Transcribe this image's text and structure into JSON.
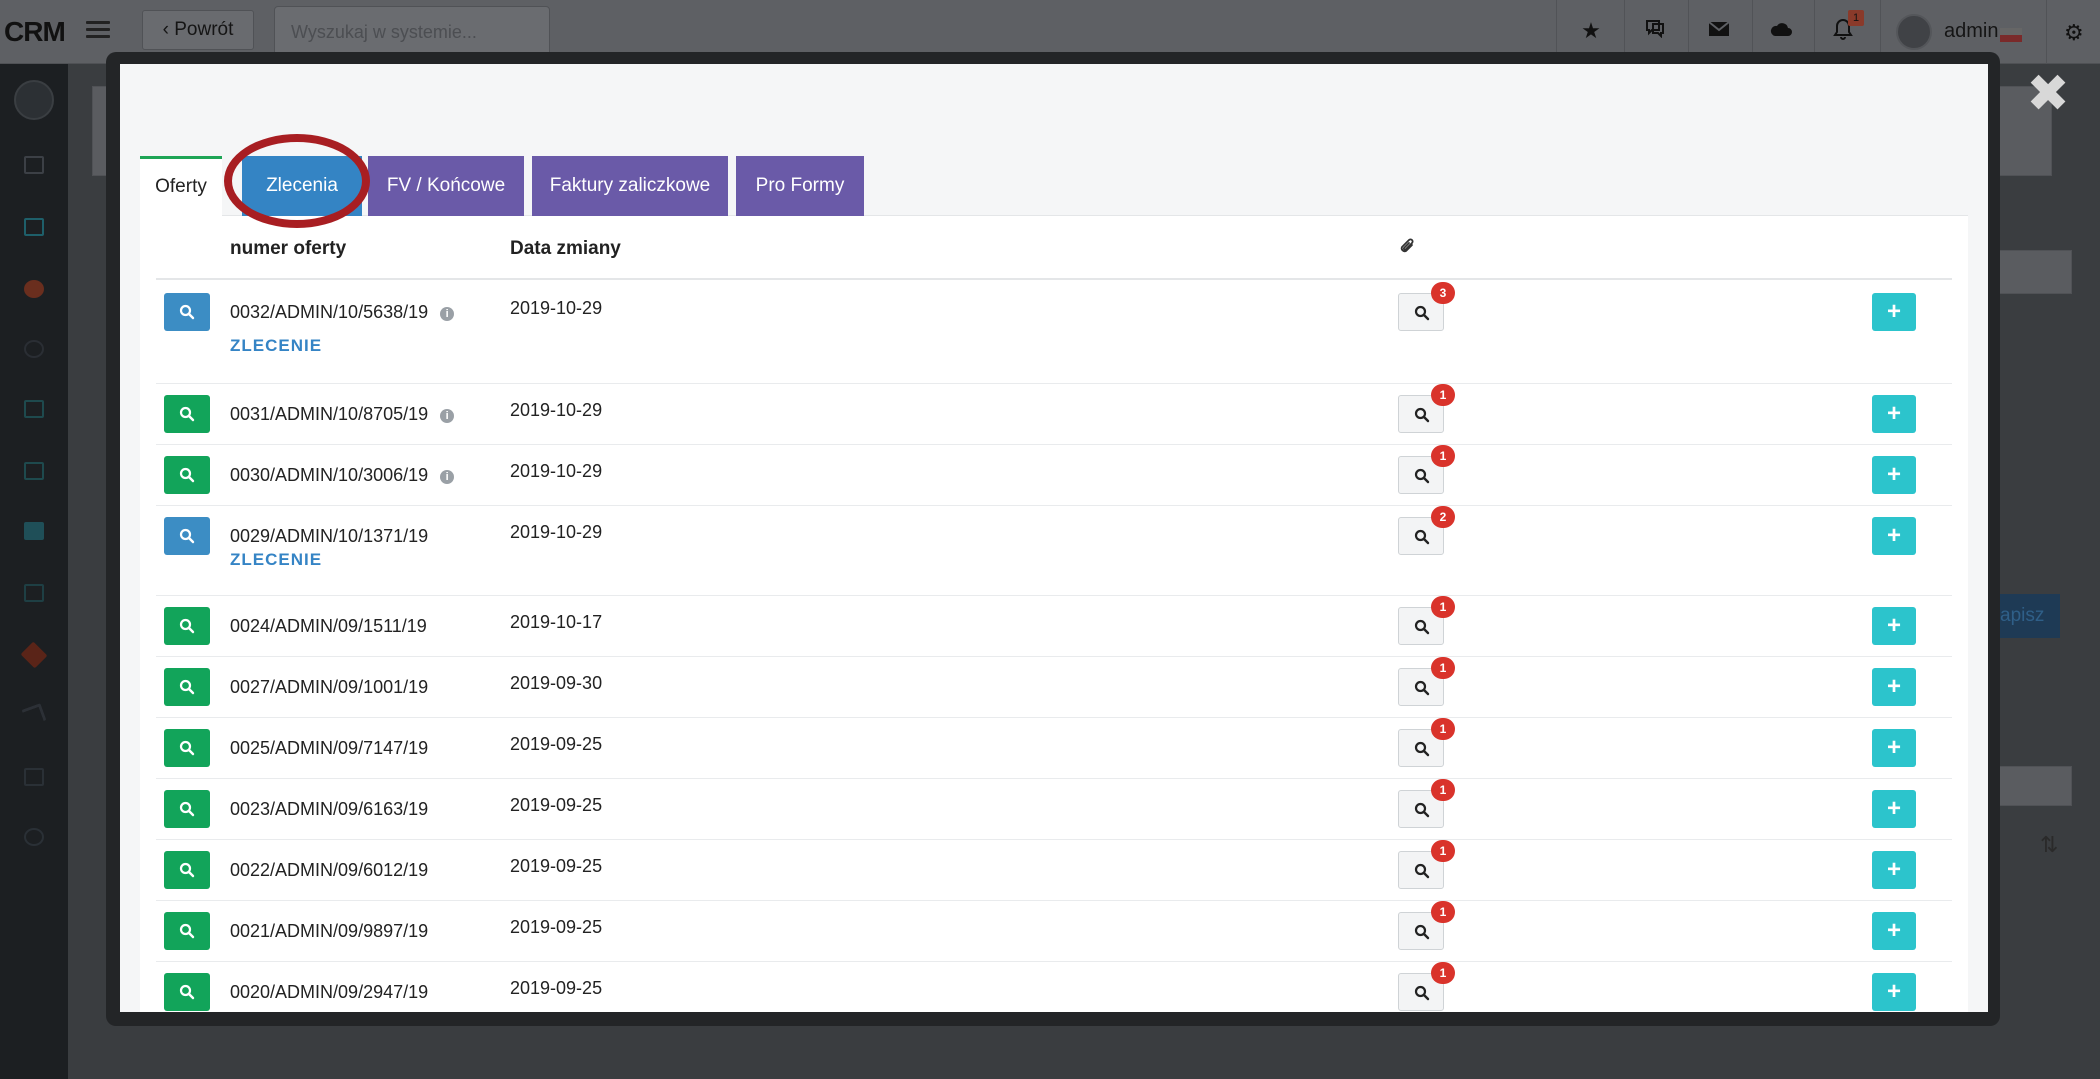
{
  "app": {
    "brand": "CRM",
    "back_label": "Powrót",
    "search_placeholder": "Wyszukaj w systemie...",
    "notification_count": "1",
    "user_name": "admin",
    "save_fragment": "apisz"
  },
  "modal": {
    "close_label": "✖",
    "tabs": [
      {
        "label": "Oferty",
        "state": "active"
      },
      {
        "label": "Zlecenia",
        "state": "highlighted"
      },
      {
        "label": "FV / Końcowe",
        "state": "normal"
      },
      {
        "label": "Faktury zaliczkowe",
        "state": "normal"
      },
      {
        "label": "Pro Formy",
        "state": "normal"
      }
    ],
    "columns": {
      "number": "numer oferty",
      "date": "Data zmiany",
      "attachments_icon": "paperclip-icon"
    },
    "rows": [
      {
        "number": "0032/ADMIN/10/5638/19",
        "info": true,
        "tag": "ZLECENIE",
        "date": "2019-10-29",
        "attachments": "3",
        "button": "blue"
      },
      {
        "number": "0031/ADMIN/10/8705/19",
        "info": true,
        "tag": "",
        "date": "2019-10-29",
        "attachments": "1",
        "button": "green"
      },
      {
        "number": "0030/ADMIN/10/3006/19",
        "info": true,
        "tag": "",
        "date": "2019-10-29",
        "attachments": "1",
        "button": "green"
      },
      {
        "number": "0029/ADMIN/10/1371/19",
        "info": false,
        "tag": "ZLECENIE",
        "date": "2019-10-29",
        "attachments": "2",
        "button": "blue"
      },
      {
        "number": "0024/ADMIN/09/1511/19",
        "info": false,
        "tag": "",
        "date": "2019-10-17",
        "attachments": "1",
        "button": "green"
      },
      {
        "number": "0027/ADMIN/09/1001/19",
        "info": false,
        "tag": "",
        "date": "2019-09-30",
        "attachments": "1",
        "button": "green"
      },
      {
        "number": "0025/ADMIN/09/7147/19",
        "info": false,
        "tag": "",
        "date": "2019-09-25",
        "attachments": "1",
        "button": "green"
      },
      {
        "number": "0023/ADMIN/09/6163/19",
        "info": false,
        "tag": "",
        "date": "2019-09-25",
        "attachments": "1",
        "button": "green"
      },
      {
        "number": "0022/ADMIN/09/6012/19",
        "info": false,
        "tag": "",
        "date": "2019-09-25",
        "attachments": "1",
        "button": "green"
      },
      {
        "number": "0021/ADMIN/09/9897/19",
        "info": false,
        "tag": "",
        "date": "2019-09-25",
        "attachments": "1",
        "button": "green"
      },
      {
        "number": "0020/ADMIN/09/2947/19",
        "info": false,
        "tag": "",
        "date": "2019-09-25",
        "attachments": "1",
        "button": "green"
      }
    ]
  },
  "colors": {
    "tab_purple": "#6a5aa8",
    "tab_highlight": "#3484c4",
    "highlight_ring": "#a81e22",
    "button_blue": "#3c8dc4",
    "button_green": "#12a45a",
    "plus_teal": "#2cc4cc",
    "badge_red": "#d9332b",
    "zlecenie_text": "#3584c5"
  }
}
